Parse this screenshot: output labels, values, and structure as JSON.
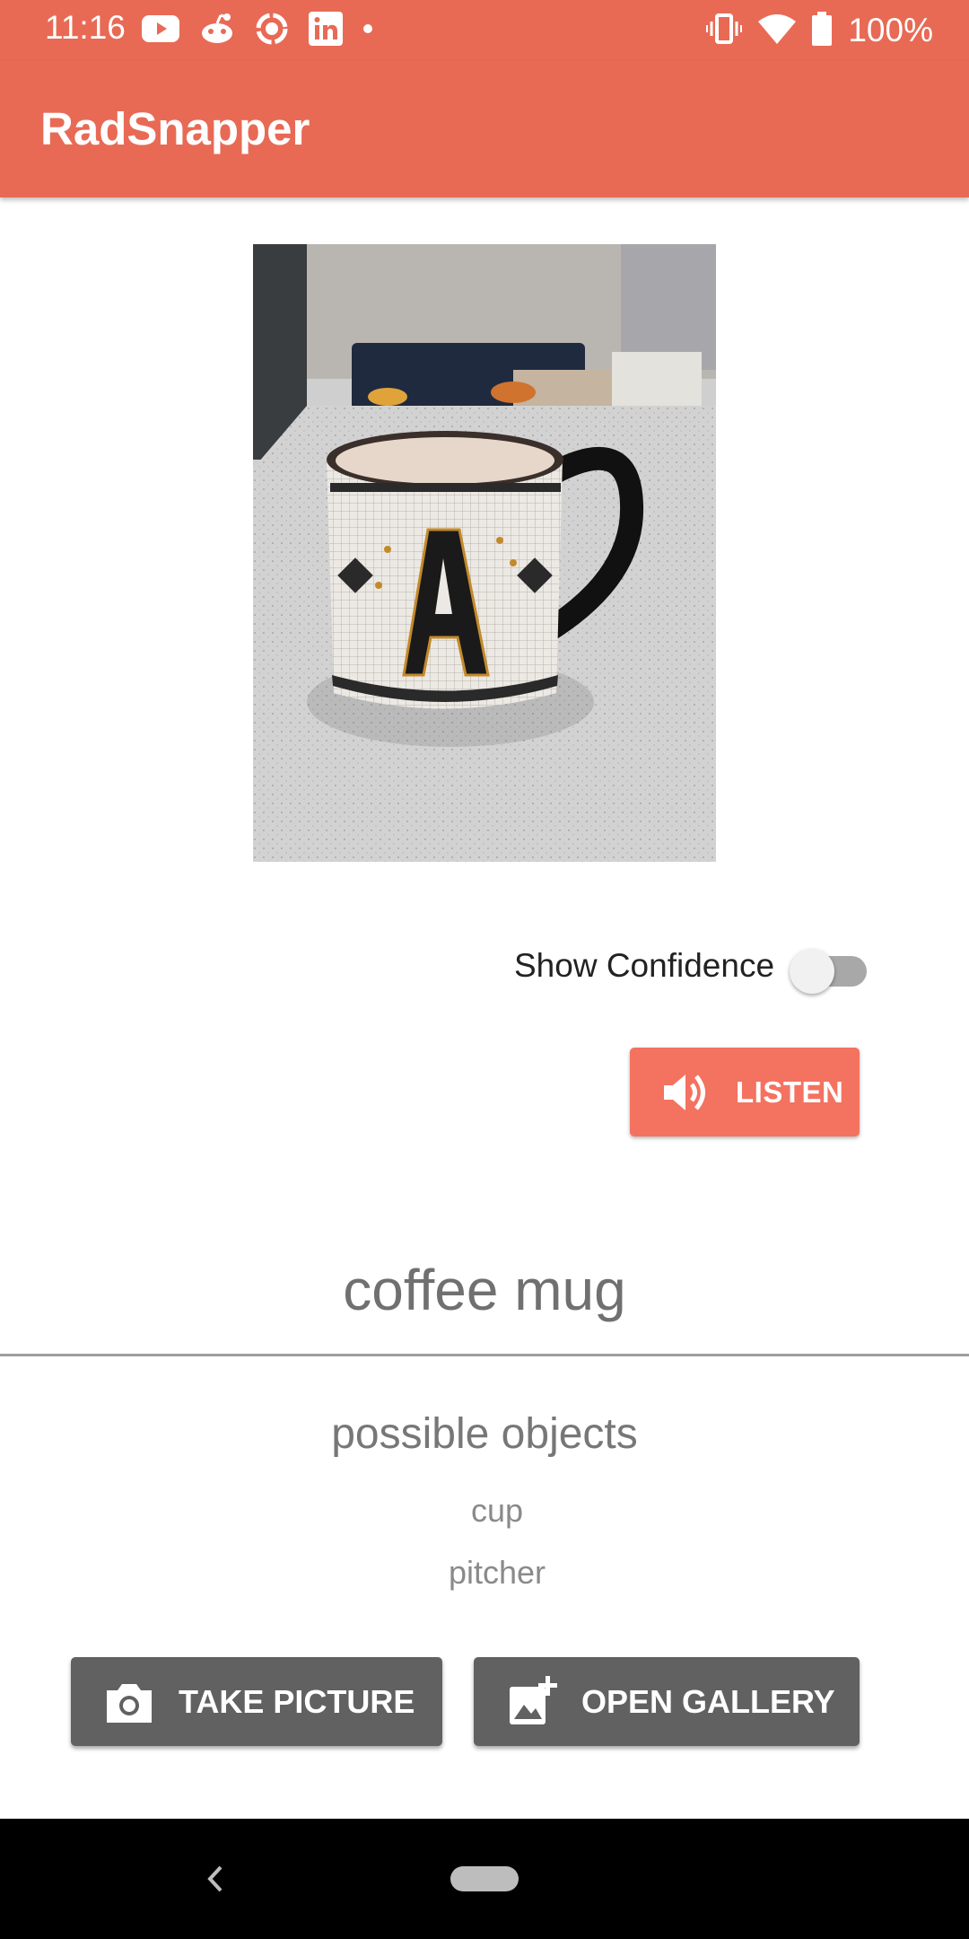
{
  "status_bar": {
    "time": "11:16",
    "battery_percent": "100%",
    "left_icons": [
      "youtube-icon",
      "reddit-icon",
      "circle-target-icon",
      "linkedin-icon",
      "dot-icon"
    ],
    "right_icons": [
      "vibrate-icon",
      "wifi-icon",
      "battery-icon"
    ]
  },
  "app_bar": {
    "title": "RadSnapper",
    "color": "#e86a55"
  },
  "controls": {
    "confidence_label": "Show Confidence",
    "confidence_on": false,
    "listen_label": "LISTEN",
    "listen_color": "#f47260"
  },
  "result": {
    "top_label": "coffee mug",
    "possible_title": "possible objects",
    "possible_objects": [
      "cup",
      "pitcher"
    ]
  },
  "actions": {
    "take_picture_label": "TAKE PICTURE",
    "open_gallery_label": "OPEN GALLERY",
    "button_color": "#616161"
  }
}
